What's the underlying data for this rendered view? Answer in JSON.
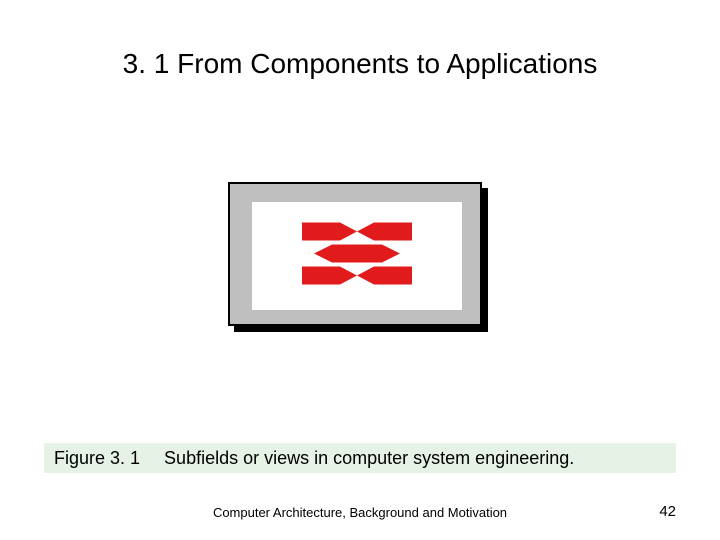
{
  "title": "3. 1  From Components to Applications",
  "figure": {
    "glyph_name": "broken-image-icon"
  },
  "caption": {
    "label": "Figure 3. 1",
    "text": "Subfields or views in computer system engineering."
  },
  "footer": {
    "text": "Computer Architecture, Background and Motivation",
    "page_number": "42"
  },
  "colors": {
    "caption_bg": "#e6f2e6",
    "glyph_red": "#e11b1b",
    "frame_gray": "#bfbfbf"
  }
}
